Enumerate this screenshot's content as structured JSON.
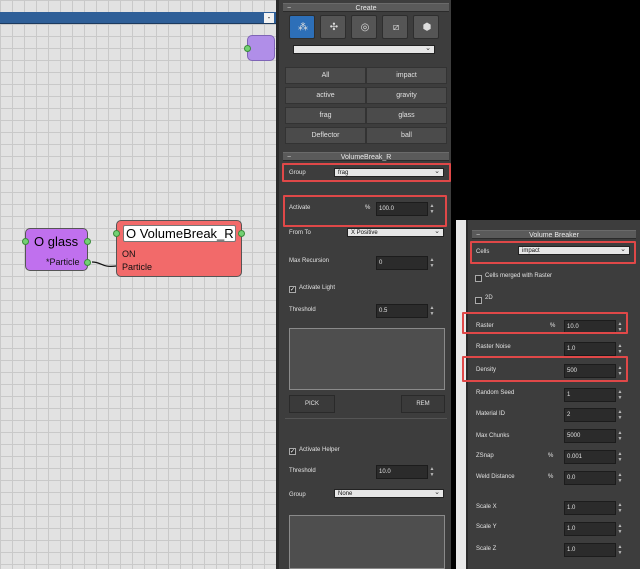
{
  "graph": {
    "topbar_button": "-",
    "nodes": {
      "glass": {
        "title": "O glass",
        "sub": "*Particle"
      },
      "volumebreak": {
        "title": "O VolumeBreak_R",
        "line1": "ON",
        "line2": "Particle"
      }
    }
  },
  "create_panel": {
    "header": "Create",
    "tool_icons": [
      "particle-group-icon",
      "force-icon",
      "target-icon",
      "slice-icon",
      "cube-icon"
    ],
    "dropdown_value": "",
    "group_buttons": [
      [
        "All",
        "impact"
      ],
      [
        "active",
        "gravity"
      ],
      [
        "frag",
        "glass"
      ],
      [
        "Deflector",
        "ball"
      ]
    ]
  },
  "volumebreak_panel": {
    "header": "VolumeBreak_R",
    "group_label": "Group",
    "group_value": "frag",
    "activate_label": "Activate",
    "activate_unit": "%",
    "activate_value": "100.0",
    "from_to_label": "From To",
    "from_to_value": "X Positive",
    "max_recursion_label": "Max Recursion",
    "max_recursion_value": "0",
    "activate_light_label": "Activate Light",
    "threshold_label": "Threshold",
    "threshold_value": "0.5",
    "pick_label": "PICK",
    "rem_label": "REM",
    "activate_helper_label": "Activate Helper",
    "helper_threshold_label": "Threshold",
    "helper_threshold_value": "10.0",
    "helper_group_label": "Group",
    "helper_group_value": "None"
  },
  "volume_breaker_panel": {
    "header": "Volume Breaker",
    "cells_label": "Cells",
    "cells_value": "impact",
    "cells_merged_label": "Cells merged with Raster",
    "two_d_label": "2D",
    "raster_label": "Raster",
    "raster_unit": "%",
    "raster_value": "10.0",
    "raster_noise_label": "Raster Noise",
    "raster_noise_value": "1.0",
    "density_label": "Density",
    "density_value": "500",
    "random_seed_label": "Random Seed",
    "random_seed_value": "1",
    "material_id_label": "Material ID",
    "material_id_value": "2",
    "max_chunks_label": "Max Chunks",
    "max_chunks_value": "5000",
    "zsnap_label": "ZSnap",
    "zsnap_unit": "%",
    "zsnap_value": "0.001",
    "weld_distance_label": "Weld Distance",
    "weld_distance_unit": "%",
    "weld_distance_value": "0.0",
    "scale_x_label": "Scale X",
    "scale_x_value": "1.0",
    "scale_y_label": "Scale Y",
    "scale_y_value": "1.0",
    "scale_z_label": "Scale Z",
    "scale_z_value": "1.0"
  },
  "colors": {
    "highlight": "#e04848",
    "glass_node": "#c070ee",
    "volumebreak_node": "#f26a6a",
    "active_tool": "#2d6fb8"
  }
}
